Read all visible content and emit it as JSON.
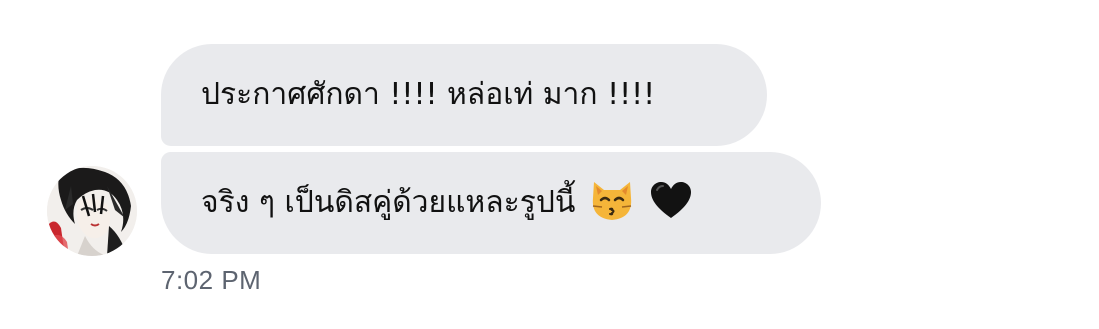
{
  "conversation": {
    "messages": [
      {
        "text": "ประกาศศักดา !!!! หล่อเท่ มาก !!!!"
      },
      {
        "text": "จริง ๆ เป็นดิสคู่ด้วยแหละรูปนี้",
        "emojis": [
          "kissing-cat-emoji",
          "black-heart-emoji"
        ]
      }
    ],
    "timestamp": "7:02 PM"
  },
  "sender": {
    "avatar_icon": "profile-photo-avatar"
  },
  "colors": {
    "bubble_background": "#e9eaed",
    "message_text": "#111111",
    "timestamp_text": "#5d6470"
  }
}
